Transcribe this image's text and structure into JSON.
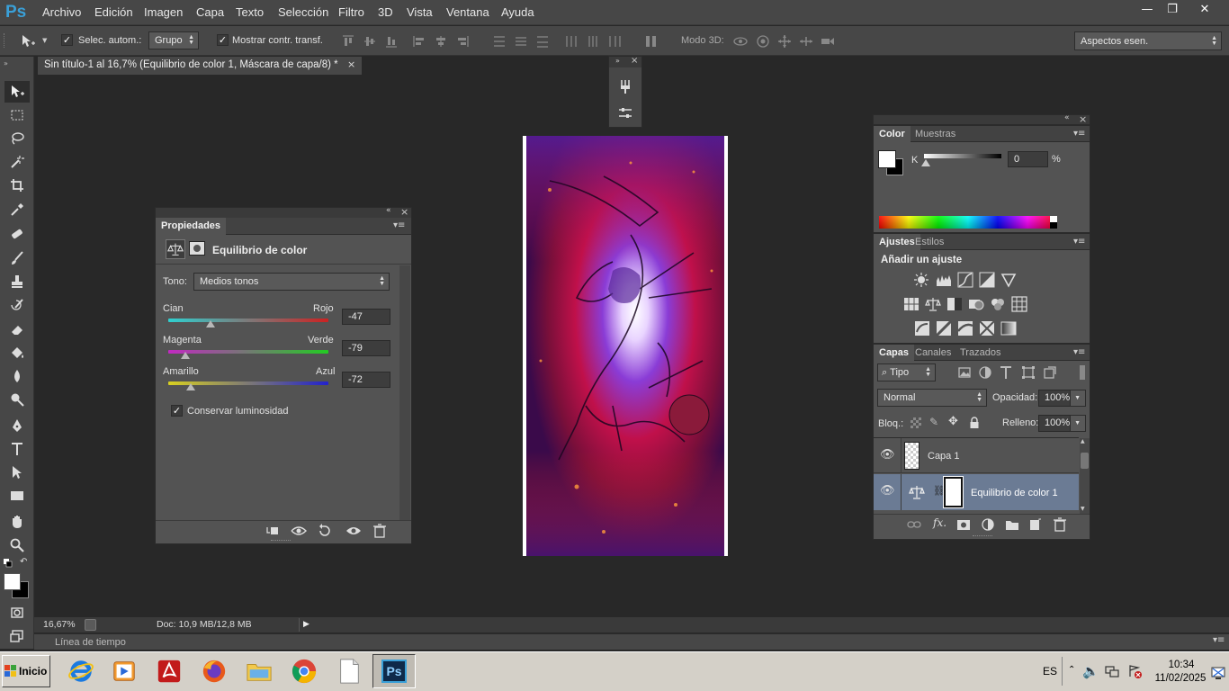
{
  "app": {
    "logo": "Ps"
  },
  "menu": [
    "Archivo",
    "Edición",
    "Imagen",
    "Capa",
    "Texto",
    "Selección",
    "Filtro",
    "3D",
    "Vista",
    "Ventana",
    "Ayuda"
  ],
  "window_controls": {
    "minimize": "—",
    "restore": "❐",
    "close": "✕"
  },
  "options": {
    "auto_select_label": "Selec. autom.:",
    "auto_select_checked": true,
    "auto_select_target": "Grupo",
    "show_transform_label": "Mostrar contr. transf.",
    "show_transform_checked": true,
    "mode3d_label": "Modo 3D:",
    "workspace": "Aspectos esen."
  },
  "document": {
    "tab_title": "Sin título-1 al 16,7% (Equilibrio de color 1, Máscara de capa/8) *",
    "close": "×",
    "zoom": "16,67%",
    "doc_info": "Doc: 10,9 MB/12,8 MB"
  },
  "properties": {
    "tab": "Propiedades",
    "title": "Equilibrio de color",
    "tono_label": "Tono:",
    "tono_value": "Medios tonos",
    "sliders": [
      {
        "left": "Cian",
        "right": "Rojo",
        "value": "-47",
        "level": -47
      },
      {
        "left": "Magenta",
        "right": "Verde",
        "value": "-79",
        "level": -79
      },
      {
        "left": "Amarillo",
        "right": "Azul",
        "value": "-72",
        "level": -72
      }
    ],
    "preserve_label": "Conservar luminosidad",
    "preserve_checked": true
  },
  "color_panel": {
    "tabs": [
      "Color",
      "Muestras"
    ],
    "channel": "K",
    "value": "0",
    "unit": "%"
  },
  "adjustments_panel": {
    "tabs": [
      "Ajustes",
      "Estilos"
    ],
    "heading": "Añadir un ajuste"
  },
  "layers_panel": {
    "tabs": [
      "Capas",
      "Canales",
      "Trazados"
    ],
    "filter": "Tipo",
    "blend_mode": "Normal",
    "opacity_label": "Opacidad:",
    "opacity": "100%",
    "lock_label": "Bloq.:",
    "fill_label": "Relleno:",
    "fill": "100%",
    "layers": [
      {
        "name": "Capa 1",
        "selected": false
      },
      {
        "name": "Equilibrio de color 1",
        "selected": true
      }
    ]
  },
  "timeline": {
    "label": "Línea de tiempo"
  },
  "taskbar": {
    "start": "Inicio",
    "lang": "ES",
    "time": "10:34",
    "date": "11/02/2025",
    "apps": [
      "internet-explorer",
      "media-player",
      "acrobat-reader",
      "firefox",
      "file-explorer",
      "chrome",
      "notepad",
      "photoshop"
    ]
  },
  "colors": {
    "accent": "#3aa0d8",
    "panel": "#535353",
    "background": "#282828",
    "selected_layer": "#6b7b94"
  }
}
